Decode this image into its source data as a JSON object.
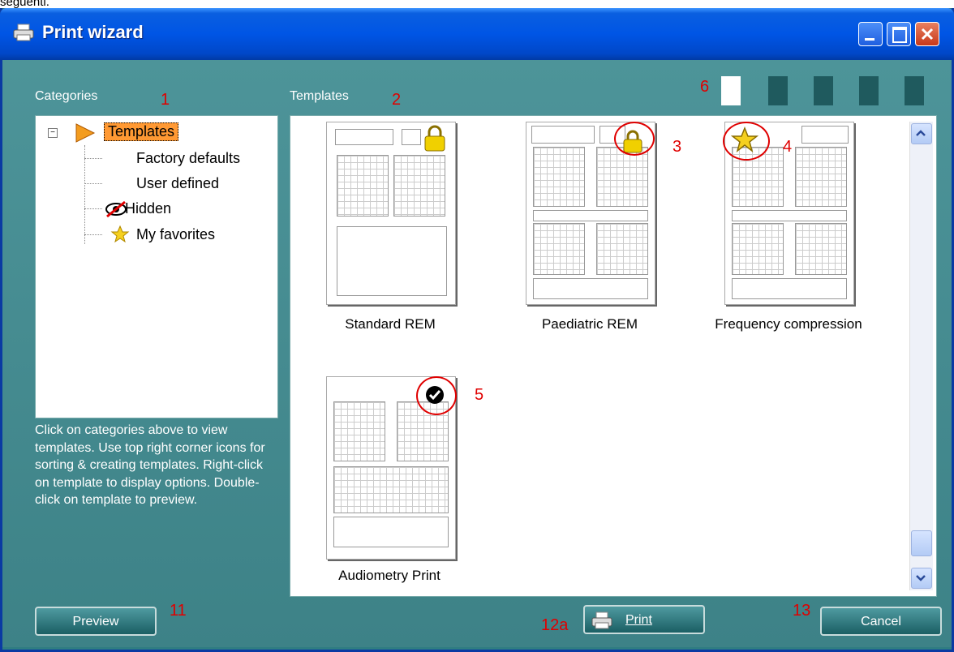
{
  "caption_top": "seguenti.",
  "window": {
    "title": "Print wizard"
  },
  "categories": {
    "label": "Categories",
    "tree": [
      {
        "label": "Templates",
        "selected": true
      },
      {
        "label": "Factory defaults"
      },
      {
        "label": "User defined"
      },
      {
        "label": "Hidden",
        "icon": "hidden-eye-icon"
      },
      {
        "label": "My favorites",
        "icon": "star-icon"
      }
    ]
  },
  "help_text": "Click on categories above to view templates. Use top right corner icons for sorting & creating templates. Right-click on template to display options. Double-click on template to preview.",
  "templates": {
    "label": "Templates",
    "items": [
      {
        "name": "Standard REM",
        "badge": "lock-icon"
      },
      {
        "name": "Paediatric REM",
        "badge": "lock-icon"
      },
      {
        "name": "Frequency compression",
        "badge": "star-icon"
      },
      {
        "name": "Audiometry Print",
        "badge": "check-icon"
      }
    ]
  },
  "annotations": {
    "n1": "1",
    "n2": "2",
    "n3": "3",
    "n4": "4",
    "n5": "5",
    "n6": "6",
    "n11": "11",
    "n12a": "12a",
    "n13": "13"
  },
  "buttons": {
    "preview": "Preview",
    "print": "Print",
    "cancel": "Cancel"
  },
  "colors": {
    "title_bar": "#0055e5",
    "client": "#3d8287",
    "annotation": "#e00000"
  }
}
